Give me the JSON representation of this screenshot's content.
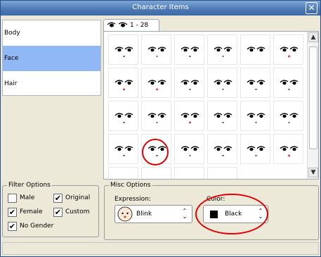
{
  "window": {
    "title": "Character Items",
    "close_label": "✕"
  },
  "categories": [
    {
      "label": "Body"
    },
    {
      "label": "Face"
    },
    {
      "label": "Hair"
    }
  ],
  "tab": {
    "label": "1 - 28"
  },
  "filter": {
    "legend": "Filter Options",
    "options": [
      {
        "label": "Male",
        "checked": false
      },
      {
        "label": "Original",
        "checked": true
      },
      {
        "label": "Female",
        "checked": true
      },
      {
        "label": "Custom",
        "checked": true
      },
      {
        "label": "No Gender",
        "checked": true
      }
    ]
  },
  "misc": {
    "legend": "Misc Options",
    "expression_label": "Expression:",
    "expression_value": "Blink",
    "color_label": "Color:",
    "color_value": "Black",
    "color_swatch": "#000000"
  },
  "annotation_color": "#e00000",
  "scroll": {
    "up_icon": "▲",
    "down_icon": "▼"
  },
  "chevron_icon": "⌃⌄"
}
